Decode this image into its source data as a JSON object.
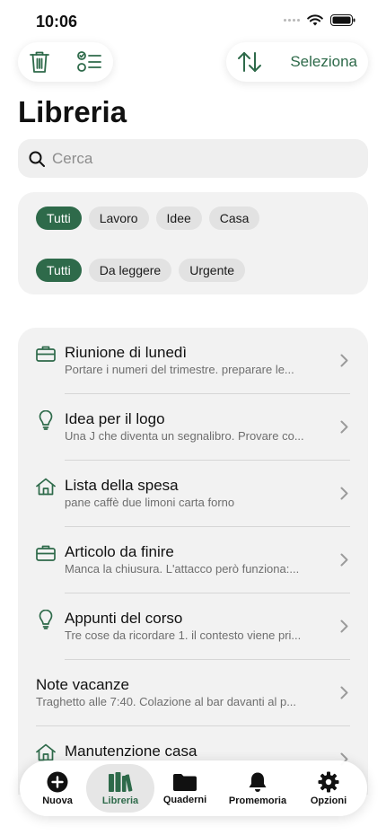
{
  "status_bar": {
    "time": "10:06"
  },
  "toolbar": {
    "select_label": "Seleziona"
  },
  "page": {
    "title": "Libreria"
  },
  "search": {
    "placeholder": "Cerca"
  },
  "filters": {
    "row1": [
      {
        "label": "Tutti",
        "active": true
      },
      {
        "label": "Lavoro",
        "active": false
      },
      {
        "label": "Idee",
        "active": false
      },
      {
        "label": "Casa",
        "active": false
      }
    ],
    "row2": [
      {
        "label": "Tutti",
        "active": true
      },
      {
        "label": "Da leggere",
        "active": false
      },
      {
        "label": "Urgente",
        "active": false
      }
    ]
  },
  "notes": [
    {
      "icon": "briefcase-icon",
      "title": "Riunione di lunedì",
      "preview": "Portare i numeri del trimestre. preparare le..."
    },
    {
      "icon": "lightbulb-icon",
      "title": "Idea per il logo",
      "preview": "Una J che diventa un segnalibro. Provare co..."
    },
    {
      "icon": "house-icon",
      "title": "Lista della spesa",
      "preview": "pane caffè due limoni carta forno"
    },
    {
      "icon": "briefcase-icon",
      "title": "Articolo da finire",
      "preview": "Manca la chiusura. L'attacco però funziona:..."
    },
    {
      "icon": "lightbulb-icon",
      "title": "Appunti del corso",
      "preview": "Tre cose da ricordare 1. il contesto viene pri..."
    },
    {
      "icon": "",
      "title": "Note vacanze",
      "preview": "Traghetto alle 7:40. Colazione al bar davanti al p..."
    },
    {
      "icon": "house-icon",
      "title": "Manutenzione casa",
      "preview": ""
    }
  ],
  "tabbar": {
    "tabs": [
      {
        "label": "Nuova",
        "icon": "plus-circle-icon",
        "active": false
      },
      {
        "label": "Libreria",
        "icon": "books-icon",
        "active": true
      },
      {
        "label": "Quaderni",
        "icon": "folder-icon",
        "active": false
      },
      {
        "label": "Promemoria",
        "icon": "bell-icon",
        "active": false
      },
      {
        "label": "Opzioni",
        "icon": "gear-icon",
        "active": false
      }
    ]
  },
  "colors": {
    "accent": "#2e6a4a",
    "card": "#f2f2f2",
    "chip": "#e2e2e2"
  }
}
